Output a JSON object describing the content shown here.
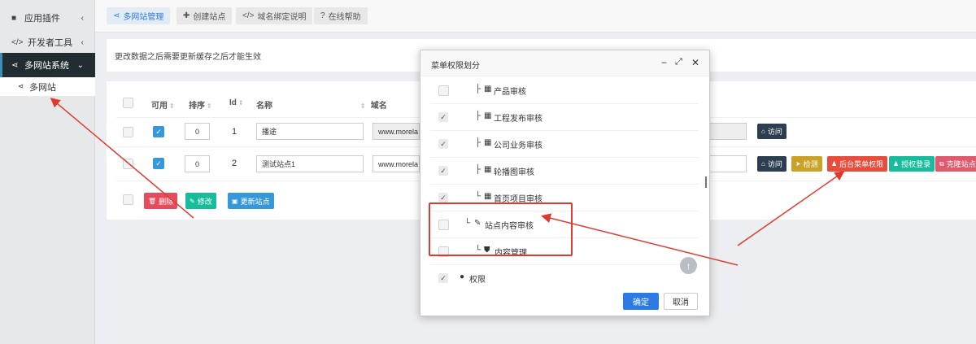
{
  "sidebar": {
    "items": [
      {
        "label": "应用插件",
        "icon": "puzzle-icon"
      },
      {
        "label": "开发者工具",
        "icon": "code-icon"
      },
      {
        "label": "多网站系统",
        "icon": "share-icon"
      }
    ],
    "sub_item": "多网站"
  },
  "tabs": [
    {
      "label": "多网站管理",
      "icon": "share-icon"
    },
    {
      "label": "创建站点",
      "icon": "plus-icon"
    },
    {
      "label": "域名绑定说明",
      "icon": "code-icon"
    },
    {
      "label": "在线帮助",
      "icon": "question-icon"
    }
  ],
  "notice": "更改数据之后需要更新缓存之后才能生效",
  "table": {
    "headers": {
      "enabled": "可用",
      "order": "排序",
      "id": "Id",
      "name": "名称",
      "domain": "域名"
    },
    "rows": [
      {
        "order": "0",
        "id": "1",
        "name": "播途",
        "domain": "www.morela"
      },
      {
        "order": "0",
        "id": "2",
        "name": "测试站点1",
        "domain": "www.morela"
      }
    ],
    "row1_actions": [
      "访问"
    ],
    "row2_actions": [
      "访问",
      "检测",
      "后台菜单权限",
      "授权登录",
      "克隆站点"
    ],
    "footer_buttons": [
      "删除",
      "修改",
      "更新站点"
    ]
  },
  "dialog": {
    "title": "菜单权限划分",
    "rows": [
      {
        "prefix": "├",
        "icon": "▦",
        "label": "产品审核",
        "checked": false
      },
      {
        "prefix": "├",
        "icon": "▦",
        "label": "工程发布审核",
        "checked": true
      },
      {
        "prefix": "├",
        "icon": "▦",
        "label": "公司业务审核",
        "checked": true
      },
      {
        "prefix": "├",
        "icon": "▦",
        "label": "轮播图审核",
        "checked": true
      },
      {
        "prefix": "└",
        "icon": "▦",
        "label": "首页项目审核",
        "checked": true
      },
      {
        "prefix": "└",
        "icon": "✎",
        "label": "站点内容审核",
        "checked": false
      },
      {
        "prefix": "└",
        "icon": "⛊",
        "label": "内容管理",
        "checked": false
      },
      {
        "prefix": "",
        "icon": "●",
        "label": "权限",
        "checked": true
      }
    ],
    "ok_label": "确定",
    "cancel_label": "取消"
  },
  "colors": {
    "accent": "#2c7be5",
    "highlight": "#e03a2f",
    "sidebar_active": "#222d32"
  }
}
